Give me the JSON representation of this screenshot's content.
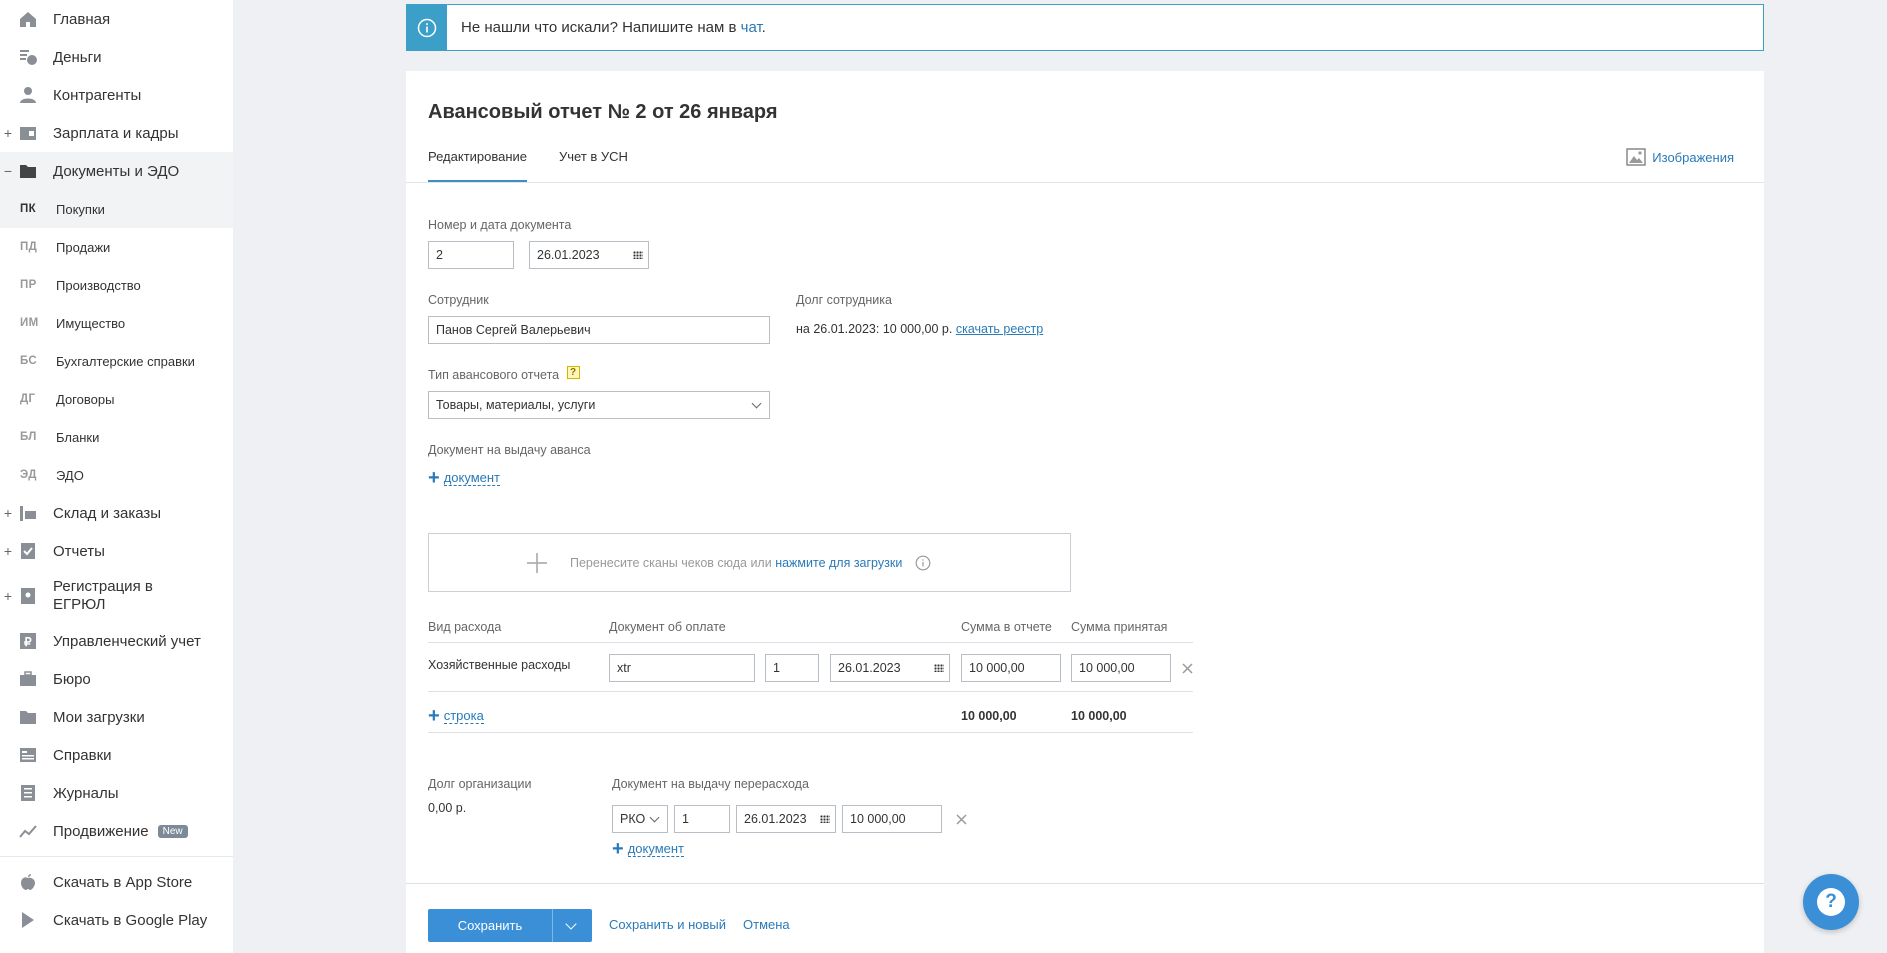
{
  "sidebar": {
    "main_items_top": [
      {
        "label": "Главная",
        "icon": "home-icon",
        "expandable": false
      },
      {
        "label": "Деньги",
        "icon": "money-icon",
        "expandable": false
      },
      {
        "label": "Контрагенты",
        "icon": "contractors-icon",
        "expandable": false
      },
      {
        "label": "Зарплата и кадры",
        "icon": "salary-icon",
        "expandable": true
      },
      {
        "label": "Документы и ЭДО",
        "icon": "folder-icon",
        "expandable": true,
        "expanded": true
      }
    ],
    "sub_items": [
      {
        "abbr": "ПК",
        "label": "Покупки",
        "active": true
      },
      {
        "abbr": "ПД",
        "label": "Продажи"
      },
      {
        "abbr": "ПР",
        "label": "Производство"
      },
      {
        "abbr": "ИМ",
        "label": "Имущество"
      },
      {
        "abbr": "БС",
        "label": "Бухгалтерские справки"
      },
      {
        "abbr": "ДГ",
        "label": "Договоры"
      },
      {
        "abbr": "БЛ",
        "label": "Бланки"
      },
      {
        "abbr": "ЭД",
        "label": "ЭДО"
      }
    ],
    "main_items_bottom": [
      {
        "label": "Склад и заказы",
        "icon": "warehouse-icon",
        "expandable": true
      },
      {
        "label": "Отчеты",
        "icon": "reports-icon",
        "expandable": true
      },
      {
        "label": "Регистрация в ЕГРЮЛ",
        "icon": "registration-icon",
        "expandable": true,
        "two_line": true
      },
      {
        "label": "Управленческий учет",
        "icon": "management-icon",
        "expandable": false
      },
      {
        "label": "Бюро",
        "icon": "briefcase-icon",
        "expandable": false
      },
      {
        "label": "Мои загрузки",
        "icon": "uploads-icon",
        "expandable": false
      },
      {
        "label": "Справки",
        "icon": "certificates-icon",
        "expandable": false
      },
      {
        "label": "Журналы",
        "icon": "journals-icon",
        "expandable": false
      },
      {
        "label": "Продвижение",
        "icon": "promotion-icon",
        "expandable": false,
        "badge": "New"
      }
    ],
    "store_items": [
      {
        "label": "Скачать в App Store",
        "icon": "apple-icon"
      },
      {
        "label": "Скачать в Google Play",
        "icon": "google-play-icon"
      }
    ]
  },
  "notice": {
    "text": "Не нашли что искали? Напишите нам в ",
    "link": "чат",
    "suffix": "."
  },
  "document": {
    "title": "Авансовый отчет № 2 от 26 января",
    "tabs": [
      "Редактирование",
      "Учет в УСН"
    ],
    "images_link": "Изображения",
    "number_date_label": "Номер и дата документа",
    "number": "2",
    "date": "26.01.2023",
    "employee_label": "Сотрудник",
    "employee": "Панов Сергей Валерьевич",
    "debt_label": "Долг сотрудника",
    "debt_text": "на 26.01.2023: 10 000,00 р. ",
    "debt_link": "скачать реестр",
    "type_label": "Тип авансового отчета",
    "type_help": "?",
    "type_value": "Товары, материалы, услуги",
    "advance_doc_label": "Документ на выдачу аванса",
    "add_document": "документ",
    "dropzone_text": "Перенесите сканы чеков сюда или ",
    "dropzone_link": "нажмите для загрузки"
  },
  "expenses": {
    "headers": [
      "Вид расхода",
      "Документ об оплате",
      "Сумма в отчете",
      "Сумма принятая"
    ],
    "rows": [
      {
        "type": "Хозяйственные расходы",
        "doc_name": "xtr",
        "doc_number": "1",
        "doc_date": "26.01.2023",
        "amount_report": "10 000,00",
        "amount_accepted": "10 000,00"
      }
    ],
    "add_row": "строка",
    "total_report": "10 000,00",
    "total_accepted": "10 000,00"
  },
  "overspend": {
    "org_debt_label": "Долг организации",
    "org_debt_value": "0,00 р.",
    "doc_label": "Документ на выдачу перерасхода",
    "doc_type": "РКО",
    "doc_number": "1",
    "doc_date": "26.01.2023",
    "doc_amount": "10 000,00",
    "add_document": "документ"
  },
  "footer": {
    "save": "Сохранить",
    "save_new": "Сохранить и новый",
    "cancel": "Отмена"
  },
  "help": "?",
  "colors": {
    "accent": "#3b8fd6",
    "link": "#2a7ab8",
    "info": "#3b9fc8"
  }
}
